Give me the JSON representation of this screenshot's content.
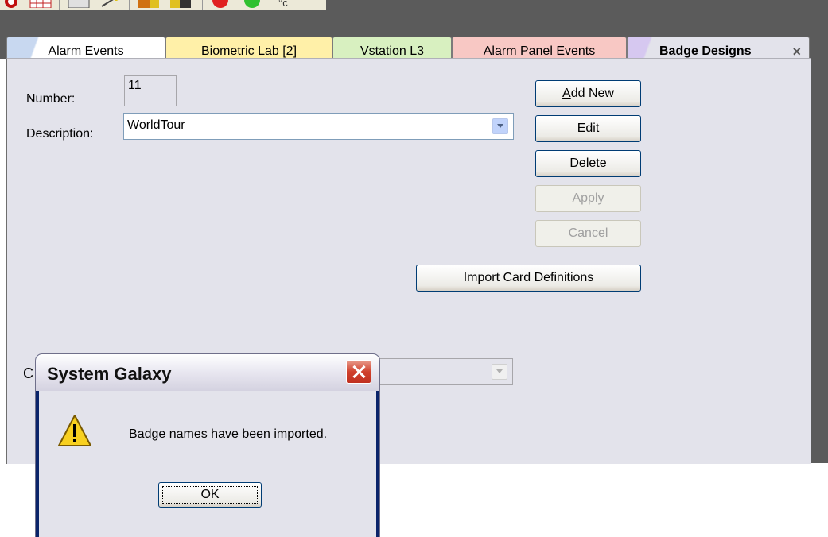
{
  "toolbar": {
    "icons": [
      "security-icon",
      "grid-icon",
      "keyboard-icon",
      "wand-icon",
      "door-exit-icon",
      "door-open-icon",
      "red-light-icon",
      "green-light-icon",
      "temperature-icon"
    ],
    "temperature_label": "°c"
  },
  "tabs": [
    {
      "label": "Alarm Events",
      "color": "#ffffff"
    },
    {
      "label": "Biometric Lab [2]",
      "color": "#fff0a8"
    },
    {
      "label": "Vstation L3",
      "color": "#d8f0c0"
    },
    {
      "label": "Alarm Panel Events",
      "color": "#f8c8c4"
    },
    {
      "label": "Badge Designs",
      "color": "#e3e3eb",
      "active": true
    }
  ],
  "tab_close": "×",
  "form": {
    "number_label": "Number:",
    "number_value": "11",
    "description_label": "Description:",
    "description_value": "WorldTour",
    "partial_label": "C"
  },
  "buttons": {
    "add_new": {
      "prefix": "",
      "accel": "A",
      "rest": "dd New"
    },
    "edit": {
      "prefix": "",
      "accel": "E",
      "rest": "dit"
    },
    "delete": {
      "prefix": "",
      "accel": "D",
      "rest": "elete"
    },
    "apply": {
      "prefix": "",
      "accel": "A",
      "rest": "pply"
    },
    "cancel": {
      "prefix": "",
      "accel": "C",
      "rest": "ancel"
    },
    "import": "Import Card Definitions"
  },
  "dialog": {
    "title": "System Galaxy",
    "message": "Badge names have been imported.",
    "ok": "OK"
  }
}
